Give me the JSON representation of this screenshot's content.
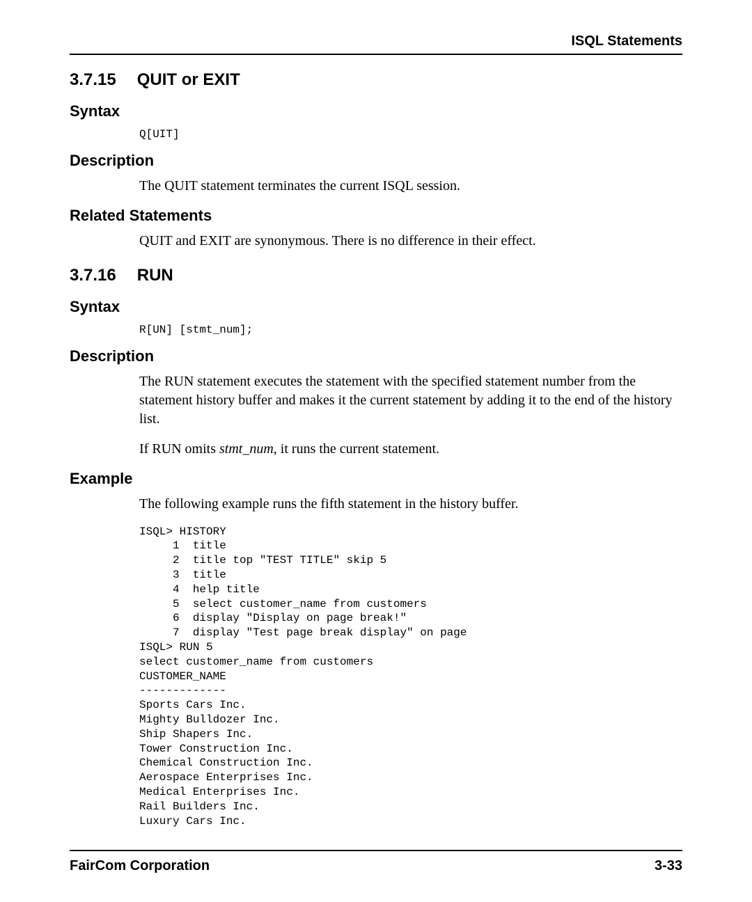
{
  "header": {
    "title": "ISQL Statements"
  },
  "section1": {
    "number": "3.7.15",
    "title": "QUIT or EXIT",
    "syntax_label": "Syntax",
    "syntax_code": "Q[UIT]",
    "description_label": "Description",
    "description_text": "The QUIT statement terminates the current ISQL session.",
    "related_label": "Related Statements",
    "related_text": "QUIT and EXIT are synonymous. There is no difference in their effect."
  },
  "section2": {
    "number": "3.7.16",
    "title": "RUN",
    "syntax_label": "Syntax",
    "syntax_code": "R[UN] [stmt_num];",
    "description_label": "Description",
    "description_text1": "The RUN statement executes the statement with the specified statement number from the statement history buffer and makes it the current statement by adding it to the end of the history list.",
    "description_text2_prefix": "If RUN omits ",
    "description_text2_italic": "stmt_num",
    "description_text2_suffix": ", it runs the current statement.",
    "example_label": "Example",
    "example_intro": "The following example runs the fifth statement in the history buffer.",
    "example_code": "ISQL> HISTORY\n     1  title\n     2  title top \"TEST TITLE\" skip 5\n     3  title\n     4  help title\n     5  select customer_name from customers\n     6  display \"Display on page break!\"\n     7  display \"Test page break display\" on page\nISQL> RUN 5\nselect customer_name from customers\nCUSTOMER_NAME\n-------------\nSports Cars Inc.\nMighty Bulldozer Inc.\nShip Shapers Inc.\nTower Construction Inc.\nChemical Construction Inc.\nAerospace Enterprises Inc.\nMedical Enterprises Inc.\nRail Builders Inc.\nLuxury Cars Inc."
  },
  "footer": {
    "company": "FairCom Corporation",
    "page": "3-33"
  }
}
